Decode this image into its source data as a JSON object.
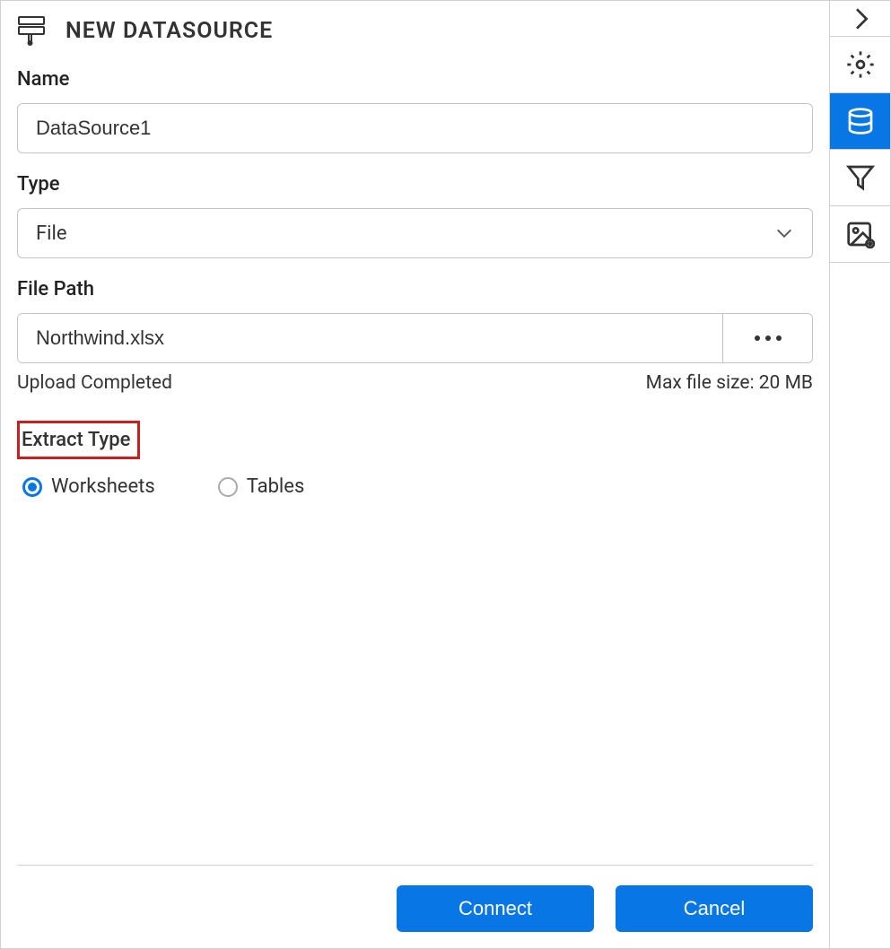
{
  "header": {
    "title": "NEW DATASOURCE"
  },
  "form": {
    "name_label": "Name",
    "name_value": "DataSource1",
    "type_label": "Type",
    "type_value": "File",
    "file_path_label": "File Path",
    "file_path_value": "Northwind.xlsx",
    "upload_status": "Upload Completed",
    "max_file_size": "Max file size: 20 MB",
    "extract_type_label": "Extract Type",
    "extract_options": {
      "worksheets": "Worksheets",
      "tables": "Tables"
    },
    "selected_extract": "worksheets"
  },
  "footer": {
    "connect_label": "Connect",
    "cancel_label": "Cancel"
  },
  "sidebar": {
    "items": [
      "expand",
      "settings",
      "datasource",
      "filter",
      "image-settings"
    ],
    "active": "datasource"
  }
}
